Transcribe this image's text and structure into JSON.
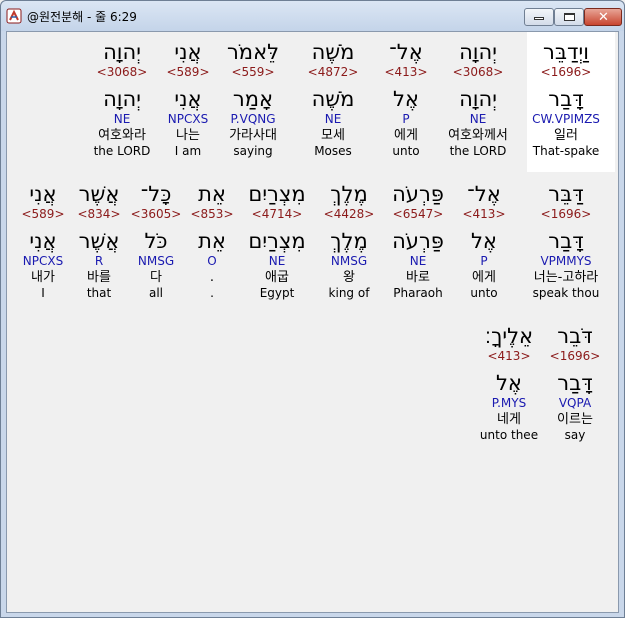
{
  "window": {
    "title": "@원전분해 - 줄 6:29",
    "minimize_icon": "minimize-icon",
    "maximize_icon": "maximize-icon",
    "close_icon": "close-icon",
    "close_glyph": "✕"
  },
  "colors": {
    "strong": "#8b1a1a",
    "morph": "#1a1ab0",
    "selected_bg": "#ffffff"
  },
  "rows": [
    {
      "words": [
        {
          "hebrew": "וַיְדַבֵּר",
          "strong": "<1696>",
          "lemma": "דָּבַר",
          "morph": "CW.VPIMZS",
          "korean": "일러",
          "english": "That-spake",
          "selected": true
        },
        {
          "hebrew": "יְהוָה",
          "strong": "<3068>",
          "lemma": "יְהוָה",
          "morph": "NE",
          "korean": "여호와께서",
          "english": "the LORD"
        },
        {
          "hebrew": "אֶל־",
          "strong": "<413>",
          "lemma": "אֶל",
          "morph": "P",
          "korean": "에게",
          "english": "unto"
        },
        {
          "hebrew": "מֹשֶׁה",
          "strong": "<4872>",
          "lemma": "מֹשֶׁה",
          "morph": "NE",
          "korean": "모세",
          "english": "Moses"
        },
        {
          "hebrew": "לֵּאמֹר",
          "strong": "<559>",
          "lemma": "אָמַר",
          "morph": "P.VQNG",
          "korean": "가라사대",
          "english": "saying"
        },
        {
          "hebrew": "אֲנִי",
          "strong": "<589>",
          "lemma": "אֲנִי",
          "morph": "NPCXS",
          "korean": "나는",
          "english": "I am"
        },
        {
          "hebrew": "יְהוָה",
          "strong": "<3068>",
          "lemma": "יְהוָה",
          "morph": "NE",
          "korean": "여호와라",
          "english": "the LORD"
        }
      ]
    },
    {
      "words": [
        {
          "hebrew": "דַּבֵּר",
          "strong": "<1696>",
          "lemma": "דָּבַר",
          "morph": "VPMMYS",
          "korean": "너는-고하라",
          "english": "speak thou"
        },
        {
          "hebrew": "אֶל־",
          "strong": "<413>",
          "lemma": "אֶל",
          "morph": "P",
          "korean": "에게",
          "english": "unto"
        },
        {
          "hebrew": "פַּרְעֹה",
          "strong": "<6547>",
          "lemma": "פַּרְעֹה",
          "morph": "NE",
          "korean": "바로",
          "english": "Pharaoh"
        },
        {
          "hebrew": "מֶלֶךְ",
          "strong": "<4428>",
          "lemma": "מֶלֶךְ",
          "morph": "NMSG",
          "korean": "왕",
          "english": "king of"
        },
        {
          "hebrew": "מִצְרַיִם",
          "strong": "<4714>",
          "lemma": "מִצְרַיִם",
          "morph": "NE",
          "korean": "애굽",
          "english": "Egypt"
        },
        {
          "hebrew": "אֵת",
          "strong": "<853>",
          "lemma": "אֵת",
          "morph": "O",
          "korean": ".",
          "english": "."
        },
        {
          "hebrew": "כָּל־",
          "strong": "<3605>",
          "lemma": "כֹּל",
          "morph": "NMSG",
          "korean": "다",
          "english": "all"
        },
        {
          "hebrew": "אֲשֶׁר",
          "strong": "<834>",
          "lemma": "אֲשֶׁר",
          "morph": "R",
          "korean": "바를",
          "english": "that"
        },
        {
          "hebrew": "אֲנִי",
          "strong": "<589>",
          "lemma": "אֲנִי",
          "morph": "NPCXS",
          "korean": "내가",
          "english": "I"
        }
      ]
    },
    {
      "words": [
        {
          "hebrew": "דֹּבֵר",
          "strong": "<1696>",
          "lemma": "דָּבַר",
          "morph": "VQPA",
          "korean": "이르는",
          "english": "say"
        },
        {
          "hebrew": "אֵלֶיךָ׃",
          "strong": "<413>",
          "lemma": "אֶל",
          "morph": "P.MYS",
          "korean": "네게",
          "english": "unto thee"
        }
      ]
    }
  ]
}
